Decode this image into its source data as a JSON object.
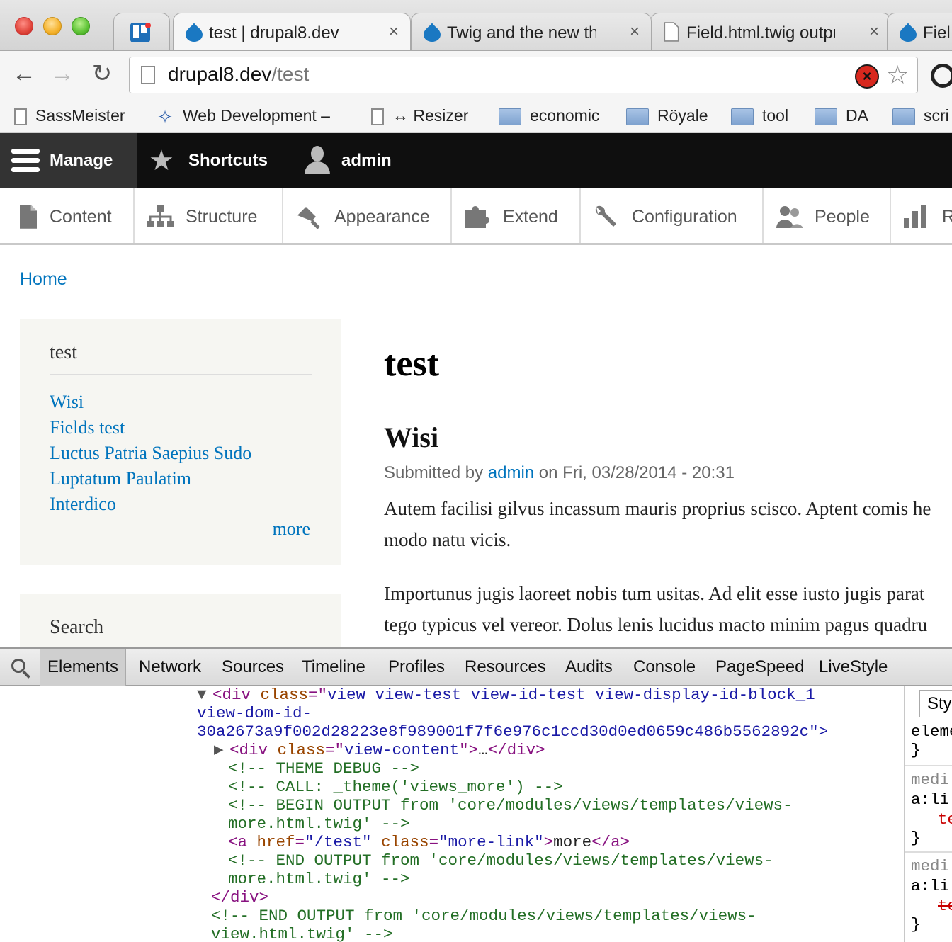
{
  "browser": {
    "tabs": [
      {
        "title": "test | drupal8.dev",
        "close": "×",
        "icon": "drupal-icon"
      },
      {
        "title": "Twig and the new the",
        "close": "×",
        "icon": "drupal-icon"
      },
      {
        "title": "Field.html.twig outpu",
        "close": "×",
        "icon": "page-icon"
      },
      {
        "title": "Fiel",
        "icon": "drupal-icon"
      }
    ],
    "url_host": "drupal8.dev",
    "url_path": "/test",
    "bookmarks": [
      {
        "label": "SassMeister",
        "icon": "page-icon"
      },
      {
        "label": "Web Development –",
        "icon": "jenkins-icon"
      },
      {
        "label": "↔ Resizer",
        "icon": "page-icon"
      },
      {
        "label": "economic",
        "icon": "folder-icon"
      },
      {
        "label": "Röyale",
        "icon": "folder-icon"
      },
      {
        "label": "tool",
        "icon": "folder-icon"
      },
      {
        "label": "DA",
        "icon": "folder-icon"
      },
      {
        "label": "scri",
        "icon": "folder-icon"
      }
    ]
  },
  "admin_bar": {
    "manage": "Manage",
    "shortcuts": "Shortcuts",
    "user": "admin"
  },
  "admin_tray": [
    {
      "label": "Content",
      "icon": "content-icon"
    },
    {
      "label": "Structure",
      "icon": "structure-icon"
    },
    {
      "label": "Appearance",
      "icon": "appearance-icon"
    },
    {
      "label": "Extend",
      "icon": "extend-icon"
    },
    {
      "label": "Configuration",
      "icon": "wrench-icon"
    },
    {
      "label": "People",
      "icon": "people-icon"
    },
    {
      "label": "R",
      "icon": "reports-icon"
    }
  ],
  "breadcrumb": {
    "home": "Home"
  },
  "sidebar": {
    "block_title": "test",
    "links": [
      "Wisi",
      "Fields test",
      "Luctus Patria Saepius Sudo",
      "Luptatum Paulatim",
      "Interdico"
    ],
    "more": "more",
    "search_title": "Search"
  },
  "main": {
    "page_title": "test",
    "node_title": "Wisi",
    "submitted_prefix": "Submitted by",
    "author": "admin",
    "submitted_suffix": "on Fri, 03/28/2014 - 20:31",
    "para1_line1": "Autem facilisi gilvus incassum mauris proprius scisco. Aptent comis he",
    "para1_line2": "modo natu vicis.",
    "para2_line1": "Importunus jugis laoreet nobis tum usitas. Ad elit esse iusto jugis parat",
    "para2_line2": "tego typicus vel vereor. Dolus lenis lucidus macto minim pagus quadru"
  },
  "devtools": {
    "tabs": [
      "Elements",
      "Network",
      "Sources",
      "Timeline",
      "Profiles",
      "Resources",
      "Audits",
      "Console",
      "PageSpeed",
      "LiveStyle"
    ],
    "active_tab": "Elements",
    "dom": {
      "l1_class": "view view-test view-id-test view-display-id-block_1",
      "l2": "view-dom-id-",
      "l3": "30a2673a9f002d28223e8f989001f7f6e976c1ccd30d0ed0659c486b5562892c\">",
      "l4_class": "view-content",
      "c1": "<!-- THEME DEBUG -->",
      "c2": "<!-- CALL: _theme('views_more') -->",
      "c3a": "<!-- BEGIN OUTPUT from 'core/modules/views/templates/views-",
      "c3b": "more.html.twig' -->",
      "a_href": "\"/test\"",
      "a_class": "\"more-link\"",
      "a_text": "more",
      "c4a": "<!-- END OUTPUT from 'core/modules/views/templates/views-",
      "c4b": "more.html.twig' -->",
      "close_div": "</div>",
      "c5a": "<!-- END OUTPUT from 'core/modules/views/templates/views-",
      "c5b": "view.html.twig' -->"
    },
    "styles": {
      "tab": "Styles",
      "lines": [
        "eleme",
        "}",
        "medi",
        "a:li",
        "te",
        "}",
        "medi",
        "a:li",
        "te",
        "}"
      ]
    }
  },
  "colors": {
    "link": "#0074bd",
    "admin_bar_bg": "#0f0f0f",
    "tag": "#881280",
    "attr_name": "#994500",
    "attr_value": "#1a1aa6",
    "comment": "#236e25"
  }
}
